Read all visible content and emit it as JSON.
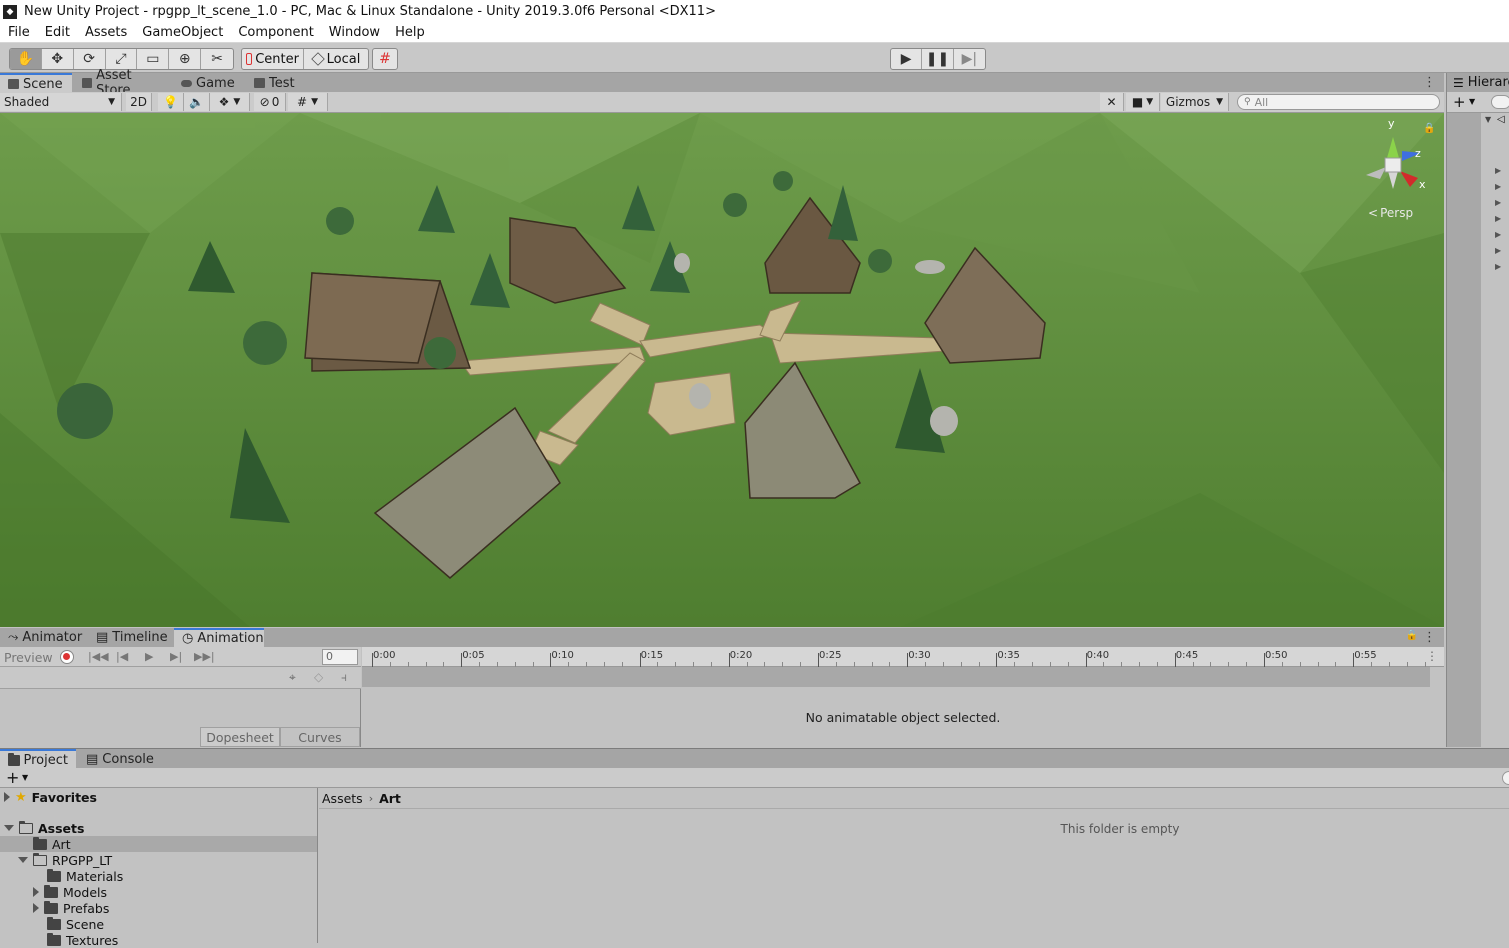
{
  "window": {
    "title": "New Unity Project - rpgpp_lt_scene_1.0 - PC, Mac & Linux Standalone - Unity 2019.3.0f6 Personal <DX11>"
  },
  "menu": [
    "File",
    "Edit",
    "Assets",
    "GameObject",
    "Component",
    "Window",
    "Help"
  ],
  "toolbar": {
    "tools": [
      "hand-tool",
      "move-tool",
      "rotate-tool",
      "scale-tool",
      "rect-tool",
      "transform-tool",
      "custom-tool"
    ],
    "pivot_label": "Center",
    "space_label": "Local"
  },
  "scene_tabs": [
    {
      "label": "Scene",
      "icon": "scene-icon",
      "active": true
    },
    {
      "label": "Asset Store",
      "icon": "store-icon",
      "active": false
    },
    {
      "label": "Game",
      "icon": "game-icon",
      "active": false
    },
    {
      "label": "Test",
      "icon": "test-icon",
      "active": false
    }
  ],
  "scene_toolbar": {
    "shading": "Shaded",
    "mode_2d": "2D",
    "hidden_count": "0",
    "gizmos": "Gizmos",
    "search_placeholder": "All"
  },
  "gizmo": {
    "y": "y",
    "z": "z",
    "x": "x",
    "persp": "Persp"
  },
  "hierarchy": {
    "title": "Hierarc"
  },
  "anim_tabs": [
    {
      "label": "Animator",
      "icon": "animator-icon",
      "active": false
    },
    {
      "label": "Timeline",
      "icon": "timeline-icon",
      "active": false
    },
    {
      "label": "Animation",
      "icon": "animation-icon",
      "active": true
    }
  ],
  "animation": {
    "preview": "Preview",
    "frame": "0",
    "ticks": [
      "0:00",
      "0:05",
      "0:10",
      "0:15",
      "0:20",
      "0:25",
      "0:30",
      "0:35",
      "0:40",
      "0:45",
      "0:50",
      "0:55"
    ],
    "message": "No animatable object selected.",
    "dopesheet": "Dopesheet",
    "curves": "Curves"
  },
  "project_tabs": [
    {
      "label": "Project",
      "active": true
    },
    {
      "label": "Console",
      "active": false
    }
  ],
  "project": {
    "favorites": "Favorites",
    "assets": "Assets",
    "tree": [
      "Art",
      "RPGPP_LT",
      "Materials",
      "Models",
      "Prefabs",
      "Scene",
      "Textures"
    ],
    "breadcrumb": [
      "Assets",
      "Art"
    ],
    "empty_message": "This folder is empty"
  },
  "colors": {
    "accent": "#3a79d8",
    "grass": "#5b8a3a",
    "record": "#d33"
  }
}
